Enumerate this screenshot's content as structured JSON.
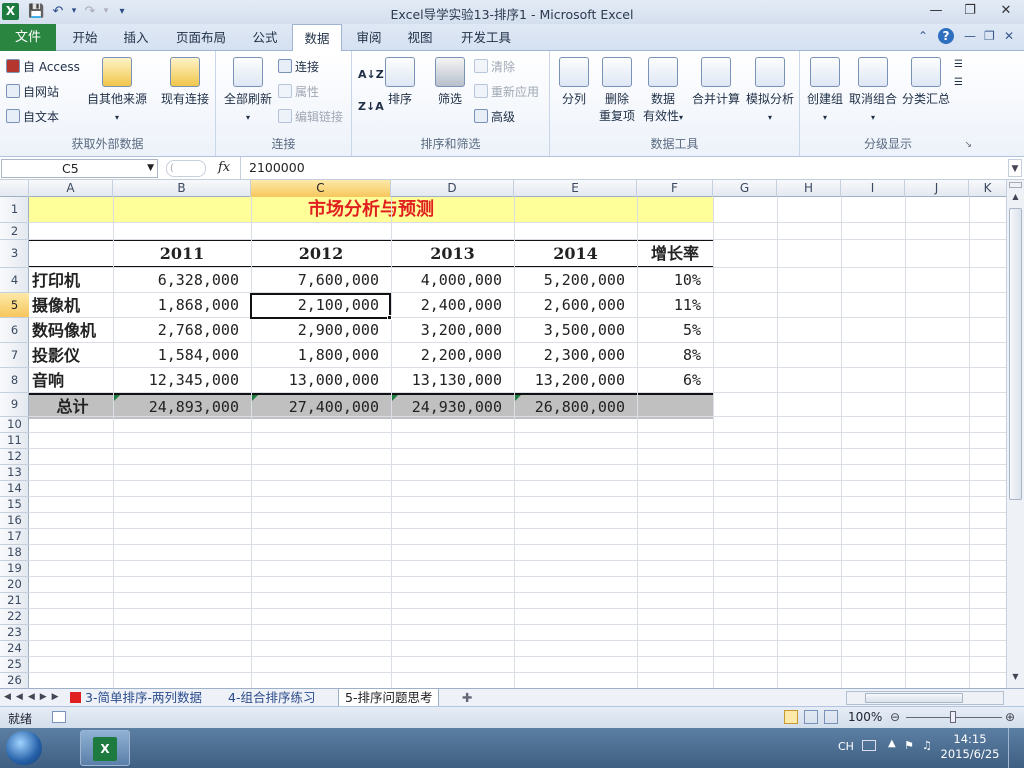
{
  "window": {
    "title": "Excel导学实验13-排序1 - Microsoft Excel",
    "app_icon": "X"
  },
  "tabs": {
    "file": "文件",
    "items": [
      "开始",
      "插入",
      "页面布局",
      "公式",
      "数据",
      "审阅",
      "视图",
      "开发工具"
    ],
    "active": "数据"
  },
  "ribbon": {
    "external": {
      "label": "获取外部数据",
      "access": "自 Access",
      "web": "自网站",
      "text": "自文本",
      "other": "自其他来源",
      "existing": "现有连接"
    },
    "connections": {
      "label": "连接",
      "refresh_all": "全部刷新",
      "connections": "连接",
      "properties": "属性",
      "edit_links": "编辑链接"
    },
    "sort_filter": {
      "label": "排序和筛选",
      "sort": "排序",
      "filter": "筛选",
      "clear": "清除",
      "reapply": "重新应用",
      "advanced": "高级"
    },
    "data_tools": {
      "label": "数据工具",
      "split": "分列",
      "remove_dup_1": "删除",
      "remove_dup_2": "重复项",
      "validation_1": "数据",
      "validation_2": "有效性",
      "consolidate": "合并计算",
      "whatif": "模拟分析"
    },
    "outline": {
      "label": "分级显示",
      "group": "创建组",
      "ungroup": "取消组合",
      "subtotal": "分类汇总"
    }
  },
  "formula_bar": {
    "name_box": "C5",
    "fx": "fx",
    "value": "2100000"
  },
  "columns": [
    "A",
    "B",
    "C",
    "D",
    "E",
    "F",
    "G",
    "H",
    "I",
    "J",
    "K"
  ],
  "rows": [
    "1",
    "2",
    "3",
    "4",
    "5",
    "6",
    "7",
    "8",
    "9",
    "10",
    "11",
    "12",
    "13",
    "14",
    "15",
    "16",
    "17",
    "18",
    "19",
    "20",
    "21",
    "22",
    "23",
    "24",
    "25",
    "26"
  ],
  "sheet": {
    "title": "市场分析与预测",
    "headers": [
      "2011",
      "2012",
      "2013",
      "2014",
      "增长率"
    ],
    "data": [
      {
        "label": "打印机",
        "values": [
          "6,328,000",
          "7,600,000",
          "4,000,000",
          "5,200,000"
        ],
        "rate": "10%"
      },
      {
        "label": "摄像机",
        "values": [
          "1,868,000",
          "2,100,000",
          "2,400,000",
          "2,600,000"
        ],
        "rate": "11%"
      },
      {
        "label": "数码像机",
        "values": [
          "2,768,000",
          "2,900,000",
          "3,200,000",
          "3,500,000"
        ],
        "rate": "5%"
      },
      {
        "label": "投影仪",
        "values": [
          "1,584,000",
          "1,800,000",
          "2,200,000",
          "2,300,000"
        ],
        "rate": "8%"
      },
      {
        "label": "音响",
        "values": [
          "12,345,000",
          "13,000,000",
          "13,130,000",
          "13,200,000"
        ],
        "rate": "6%"
      }
    ],
    "total": {
      "label": "总计",
      "values": [
        "24,893,000",
        "27,400,000",
        "24,930,000",
        "26,800,000"
      ]
    },
    "selected_cell": "C5"
  },
  "sheet_tabs": [
    "3-简单排序-两列数据",
    "4-组合排序练习",
    "5-排序问题思考"
  ],
  "active_sheet": "5-排序问题思考",
  "status": {
    "ready": "就绪",
    "zoom": "100%"
  },
  "taskbar": {
    "lang": "CH",
    "time": "14:15",
    "date": "2015/6/25"
  },
  "colors": {
    "title_fill": "#ffff99",
    "title_text": "#e02020",
    "total_fill": "#c0c0c0",
    "file_tab": "#2a8540",
    "selected_header": "#f6c75d"
  }
}
